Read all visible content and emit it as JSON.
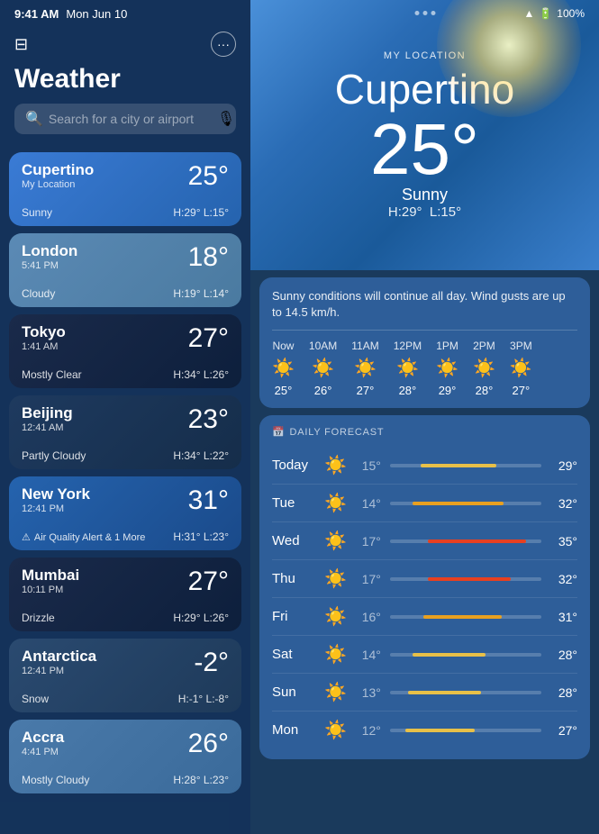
{
  "statusBar": {
    "time": "9:41 AM",
    "date": "Mon Jun 10",
    "wifi": "100%"
  },
  "leftPanel": {
    "title": "Weather",
    "search": {
      "placeholder": "Search for a city or airport"
    },
    "cities": [
      {
        "name": "Cupertino",
        "sublabel": "My Location",
        "time": "",
        "temp": "25°",
        "condition": "Sunny",
        "high": "H:29°",
        "low": "L:15°",
        "style": "active"
      },
      {
        "name": "London",
        "sublabel": "",
        "time": "5:41 PM",
        "temp": "18°",
        "condition": "Cloudy",
        "high": "H:19°",
        "low": "L:14°",
        "style": "london"
      },
      {
        "name": "Tokyo",
        "sublabel": "",
        "time": "1:41 AM",
        "temp": "27°",
        "condition": "Mostly Clear",
        "high": "H:34°",
        "low": "L:26°",
        "style": "tokyo"
      },
      {
        "name": "Beijing",
        "sublabel": "",
        "time": "12:41 AM",
        "temp": "23°",
        "condition": "Partly Cloudy",
        "high": "H:34°",
        "low": "L:22°",
        "style": "beijing"
      },
      {
        "name": "New York",
        "sublabel": "",
        "time": "12:41 PM",
        "temp": "31°",
        "condition": "Air Quality Alert & 1 More",
        "high": "H:31°",
        "low": "L:23°",
        "style": "newyork",
        "alert": true
      },
      {
        "name": "Mumbai",
        "sublabel": "",
        "time": "10:11 PM",
        "temp": "27°",
        "condition": "Drizzle",
        "high": "H:29°",
        "low": "L:26°",
        "style": "mumbai"
      },
      {
        "name": "Antarctica",
        "sublabel": "",
        "time": "12:41 PM",
        "temp": "-2°",
        "condition": "Snow",
        "high": "H:-1°",
        "low": "L:-8°",
        "style": "antarctica"
      },
      {
        "name": "Accra",
        "sublabel": "",
        "time": "4:41 PM",
        "temp": "26°",
        "condition": "Mostly Cloudy",
        "high": "H:28°",
        "low": "L:23°",
        "style": "accra"
      }
    ]
  },
  "rightPanel": {
    "myLocationLabel": "MY LOCATION",
    "heroCity": "Cupertino",
    "heroTemp": "25°",
    "heroCondition": "Sunny",
    "heroHigh": "H:29°",
    "heroLow": "L:15°",
    "hourlyDesc": "Sunny conditions will continue all day. Wind gusts are up to 14.5 km/h.",
    "hourly": [
      {
        "label": "Now",
        "icon": "☀️",
        "temp": "25°"
      },
      {
        "label": "10AM",
        "icon": "☀️",
        "temp": "26°"
      },
      {
        "label": "11AM",
        "icon": "☀️",
        "temp": "27°"
      },
      {
        "label": "12PM",
        "icon": "☀️",
        "temp": "28°"
      },
      {
        "label": "1PM",
        "icon": "☀️",
        "temp": "29°"
      },
      {
        "label": "2PM",
        "icon": "☀️",
        "temp": "28°"
      },
      {
        "label": "3PM",
        "icon": "☀️",
        "temp": "27°"
      }
    ],
    "dailyHeader": "DAILY FORECAST",
    "daily": [
      {
        "day": "Today",
        "icon": "☀️",
        "low": "15°",
        "high": "29°",
        "barLeft": "20%",
        "barWidth": "50%",
        "barColor": "#e8c048"
      },
      {
        "day": "Tue",
        "icon": "☀️",
        "low": "14°",
        "high": "32°",
        "barLeft": "15%",
        "barWidth": "60%",
        "barColor": "#e8a020"
      },
      {
        "day": "Wed",
        "icon": "☀️",
        "low": "17°",
        "high": "35°",
        "barLeft": "25%",
        "barWidth": "65%",
        "barColor": "#e84020"
      },
      {
        "day": "Thu",
        "icon": "☀️",
        "low": "17°",
        "high": "32°",
        "barLeft": "25%",
        "barWidth": "55%",
        "barColor": "#e84020"
      },
      {
        "day": "Fri",
        "icon": "☀️",
        "low": "16°",
        "high": "31°",
        "barLeft": "22%",
        "barWidth": "52%",
        "barColor": "#e8a020"
      },
      {
        "day": "Sat",
        "icon": "☀️",
        "low": "14°",
        "high": "28°",
        "barLeft": "15%",
        "barWidth": "48%",
        "barColor": "#e8c048"
      },
      {
        "day": "Sun",
        "icon": "☀️",
        "low": "13°",
        "high": "28°",
        "barLeft": "12%",
        "barWidth": "48%",
        "barColor": "#e8c048"
      },
      {
        "day": "Mon",
        "icon": "☀️",
        "low": "12°",
        "high": "27°",
        "barLeft": "10%",
        "barWidth": "46%",
        "barColor": "#e8c048"
      }
    ]
  }
}
